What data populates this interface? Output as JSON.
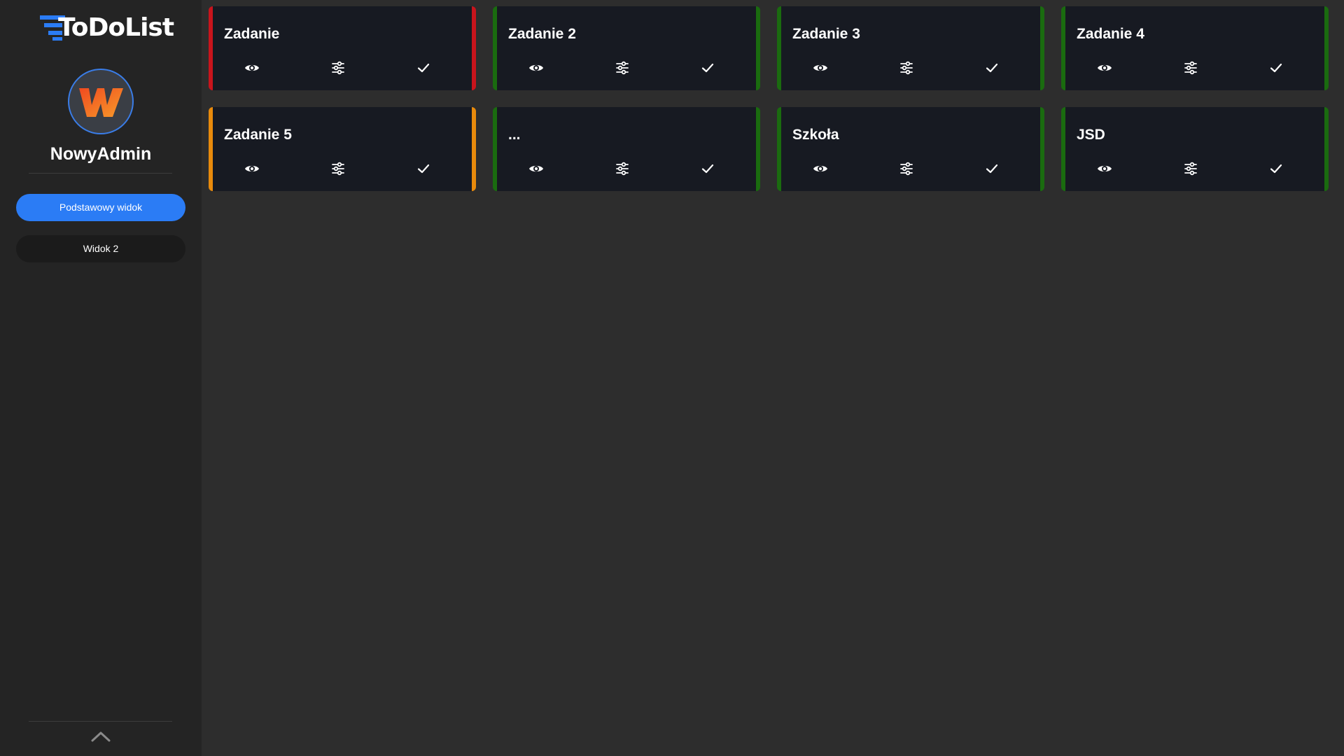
{
  "app": {
    "title": "ToDoList"
  },
  "colors": {
    "accent": "#2b7cf5",
    "priority_high": "#c8141c",
    "priority_medium": "#e88a0c",
    "priority_low": "#1a6b0f"
  },
  "sidebar": {
    "username": "NowyAdmin",
    "nav": [
      {
        "label": "Podstawowy widok",
        "active": true
      },
      {
        "label": "Widok 2",
        "active": false
      }
    ]
  },
  "tasks": [
    {
      "title": "Zadanie",
      "status": "red",
      "actions": [
        "eye-icon",
        "sliders-icon",
        "check-icon"
      ]
    },
    {
      "title": "Zadanie 2",
      "status": "green",
      "actions": [
        "eye-icon",
        "sliders-icon",
        "check-icon"
      ]
    },
    {
      "title": "Zadanie 3",
      "status": "green",
      "actions": [
        "eye-icon",
        "sliders-icon",
        "check-icon"
      ]
    },
    {
      "title": "Zadanie 4",
      "status": "green",
      "actions": [
        "eye-icon",
        "sliders-icon",
        "check-icon"
      ]
    },
    {
      "title": "Zadanie 5",
      "status": "orange",
      "actions": [
        "eye-icon",
        "sliders-icon",
        "check-icon"
      ]
    },
    {
      "title": "...",
      "status": "green",
      "actions": [
        "eye-icon",
        "sliders-icon",
        "check-icon"
      ]
    },
    {
      "title": "Szkoła",
      "status": "green",
      "actions": [
        "eye-icon",
        "sliders-icon",
        "check-icon"
      ]
    },
    {
      "title": "JSD",
      "status": "green",
      "actions": [
        "eye-icon",
        "sliders-icon",
        "check-icon"
      ]
    }
  ]
}
